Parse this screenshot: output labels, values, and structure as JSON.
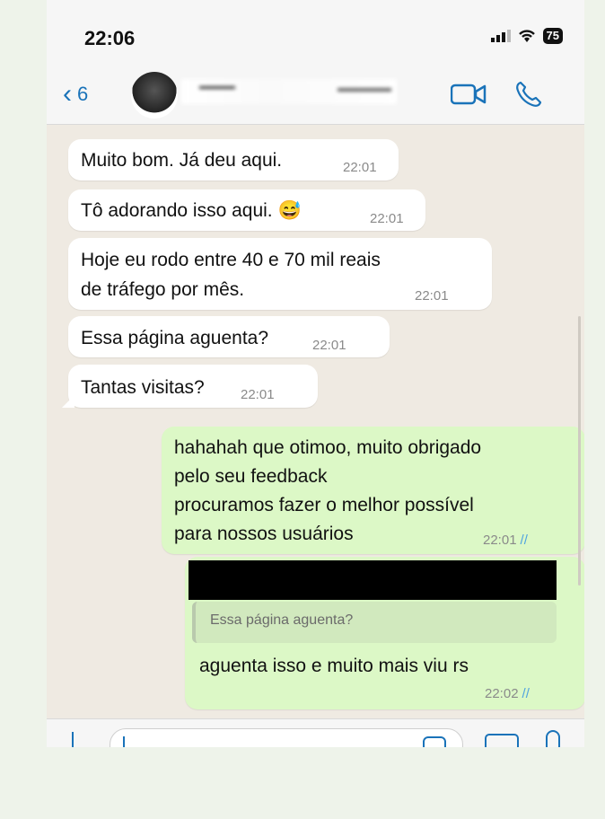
{
  "status": {
    "time": "22:06",
    "battery": "75"
  },
  "header": {
    "back_count": "6"
  },
  "messages": [
    {
      "text": "Muito bom. Já deu aqui.",
      "time": "22:01"
    },
    {
      "text": "Tô adorando isso aqui. 😅",
      "time": "22:01"
    },
    {
      "text_line1": "Hoje eu rodo entre 40 e 70 mil reais",
      "text_line2": "de tráfego por mês.",
      "time": "22:01"
    },
    {
      "text": "Essa página aguenta?",
      "time": "22:01"
    },
    {
      "text": "Tantas visitas?",
      "time": "22:01"
    }
  ],
  "outgoing": [
    {
      "lines": [
        "hahahah que otimoo, muito obrigado",
        "pelo seu feedback",
        "procuramos fazer o melhor possível",
        "para nossos usuários"
      ],
      "time": "22:01"
    },
    {
      "quoted": "Essa página aguenta?",
      "text": "aguenta isso e muito mais viu rs",
      "time": "22:02"
    }
  ],
  "icons": {
    "read_ticks": "//",
    "back": "chevron-left-icon",
    "video": "video-camera-icon",
    "call": "phone-icon"
  },
  "colors": {
    "accent": "#1a73b9",
    "outgoing_bubble": "#dcf8c6",
    "chat_background": "#efeae2"
  }
}
